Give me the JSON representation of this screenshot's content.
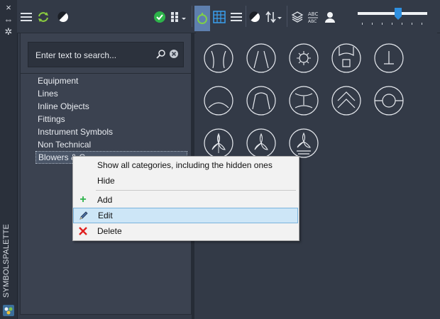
{
  "title_strip": {
    "title": "SYMBOLSPALETTE",
    "controls": [
      "×",
      "⇔",
      "✲"
    ]
  },
  "search": {
    "placeholder": "Enter text to search..."
  },
  "tree": {
    "items": [
      "Equipment",
      "Lines",
      "Inline Objects",
      "Fittings",
      "Instrument Symbols",
      "Non Technical"
    ],
    "selected_visible": "Blowers & C"
  },
  "context_menu": {
    "show_all": "Show all categories, including the hidden ones",
    "hide": "Hide",
    "add": "Add",
    "edit": "Edit",
    "delete": "Delete"
  },
  "toolbar": {
    "slider_level": 0.63,
    "icons": [
      "menu-icon",
      "refresh-icon",
      "contrast-icon",
      "check-icon",
      "grid-dropdown-icon",
      "tree-view-icon",
      "table-icon",
      "list-icon",
      "contrast-icon",
      "sort-icon",
      "layers-icon",
      "abc-icon",
      "user-icon"
    ]
  },
  "symbols": [
    "blower-symbol-1",
    "blower-symbol-2",
    "blower-symbol-3",
    "blower-symbol-4",
    "blower-symbol-5",
    "blower-symbol-6",
    "blower-symbol-7",
    "blower-symbol-8",
    "blower-symbol-9",
    "blower-symbol-10",
    "blower-symbol-11",
    "blower-symbol-12",
    "blower-symbol-13"
  ],
  "colors": {
    "background": "#333a47",
    "highlight": "#cde6f7",
    "accent_green": "#2db34a",
    "delete_red": "#e02020",
    "slider_blue": "#2e8fe0"
  }
}
